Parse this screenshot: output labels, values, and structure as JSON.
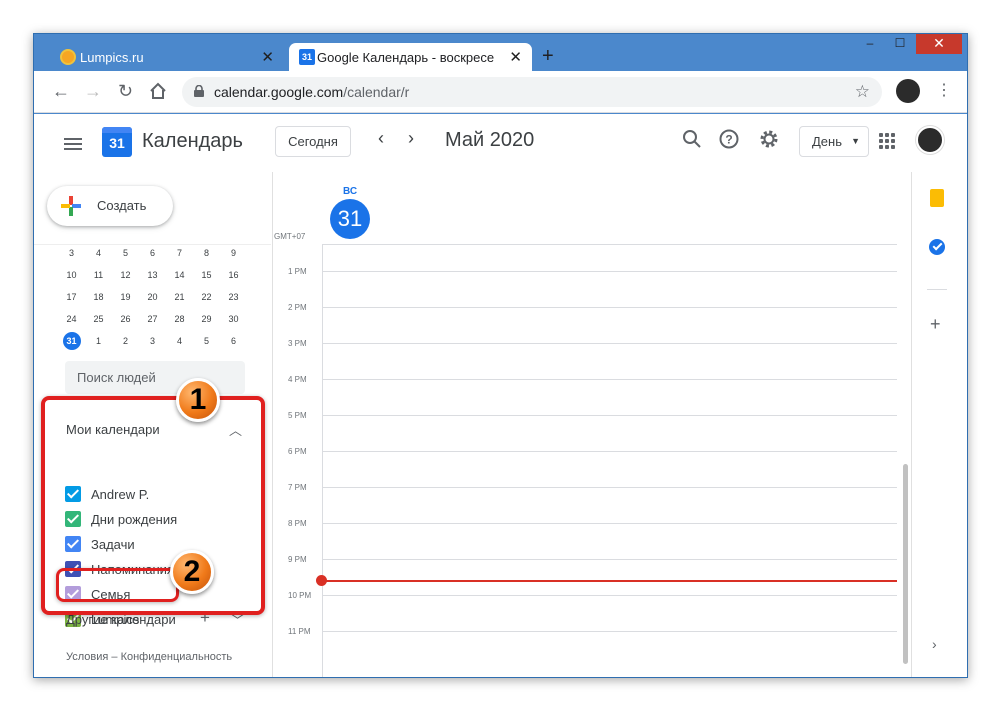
{
  "browser": {
    "tabs": [
      {
        "title": "Lumpics.ru",
        "icon": "lumpics-favicon-icon"
      },
      {
        "title": "Google Календарь - воскресенье",
        "icon": "calendar-favicon-icon"
      }
    ],
    "url_host": "calendar.google.com",
    "url_path": "/calendar/r",
    "window_controls": {
      "minimize": "–",
      "maximize": "☐",
      "close": "✕"
    }
  },
  "header": {
    "app_title": "Календарь",
    "logo_day": "31",
    "today_button": "Сегодня",
    "month_label": "Май 2020",
    "view_select": "День"
  },
  "sidebar": {
    "create_button": "Создать",
    "mini_calendar": {
      "weeks": [
        [
          "3",
          "4",
          "5",
          "6",
          "7",
          "8",
          "9"
        ],
        [
          "10",
          "11",
          "12",
          "13",
          "14",
          "15",
          "16"
        ],
        [
          "17",
          "18",
          "19",
          "20",
          "21",
          "22",
          "23"
        ],
        [
          "24",
          "25",
          "26",
          "27",
          "28",
          "29",
          "30"
        ],
        [
          "31",
          "1",
          "2",
          "3",
          "4",
          "5",
          "6"
        ]
      ],
      "selected": "31"
    },
    "search_people_placeholder": "Поиск людей",
    "my_calendars_title": "Мои календари",
    "my_calendars": [
      {
        "label": "Andrew P.",
        "color": "#039be5",
        "checked": true
      },
      {
        "label": "Дни рождения",
        "color": "#33b679",
        "checked": true
      },
      {
        "label": "Задачи",
        "color": "#4285f4",
        "checked": true
      },
      {
        "label": "Напоминания",
        "color": "#3f51b5",
        "checked": true
      },
      {
        "label": "Семья",
        "color": "#b39ddb",
        "checked": true
      },
      {
        "label": "Lumpics",
        "color": "#7cb342",
        "checked": true
      }
    ],
    "other_calendars_title": "Другие календари",
    "footer": "Условия – Конфиденциальность"
  },
  "day_view": {
    "weekday": "ВС",
    "day_number": "31",
    "timezone": "GMT+07",
    "hours": [
      "1 PM",
      "2 PM",
      "3 PM",
      "4 PM",
      "5 PM",
      "6 PM",
      "7 PM",
      "8 PM",
      "9 PM",
      "10 PM",
      "11 PM"
    ]
  },
  "annotations": {
    "badge_1": "1",
    "badge_2": "2"
  }
}
